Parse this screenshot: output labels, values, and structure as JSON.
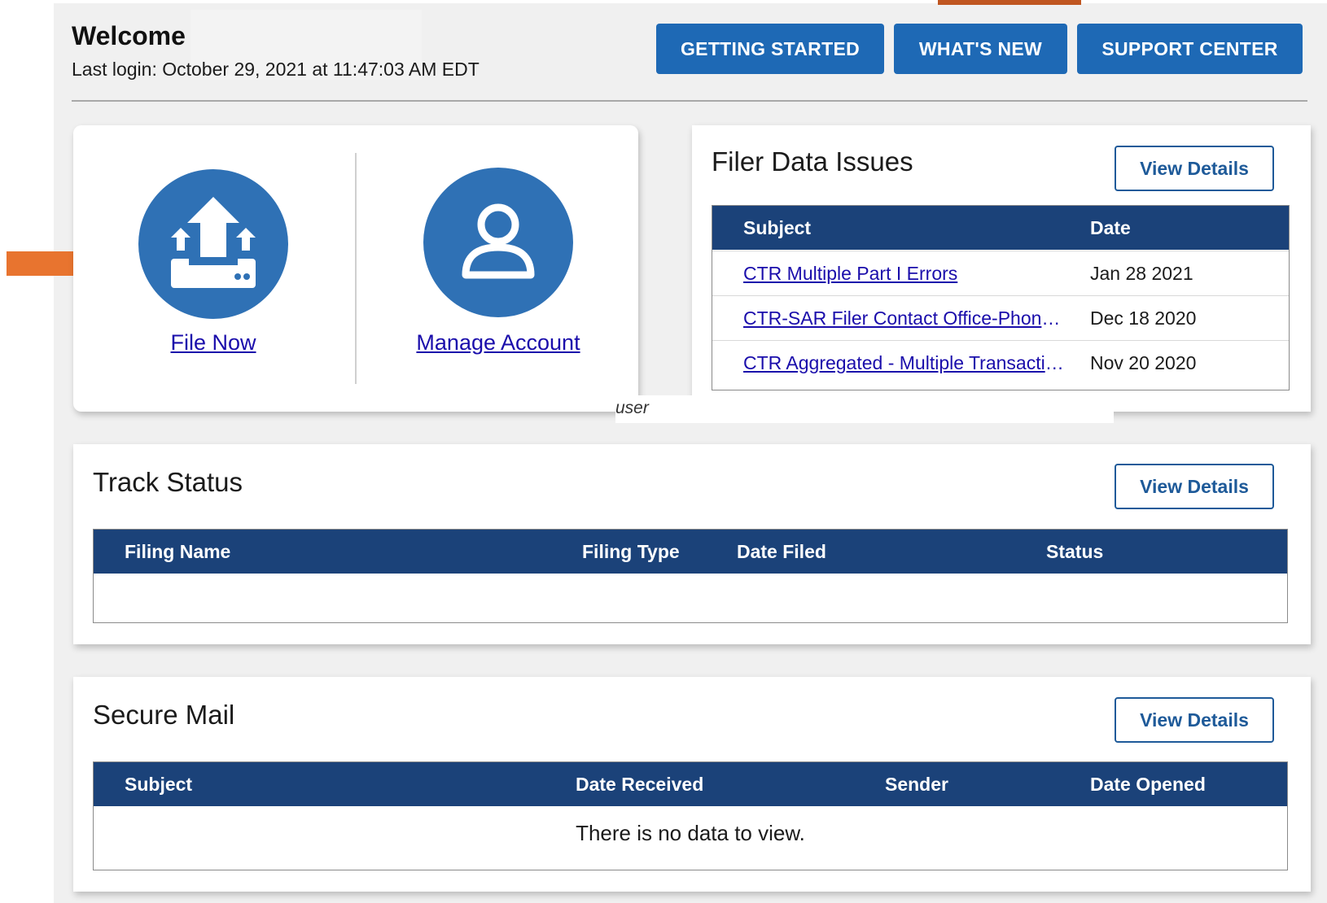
{
  "colors": {
    "primary_button": "#1e69b5",
    "table_header": "#1b4279",
    "icon_circle": "#2f71b5",
    "link": "#1a0dab",
    "annotation_arrow": "#e8742f"
  },
  "header": {
    "title": "Welcome",
    "last_login": "Last login: October 29, 2021 at 11:47:03 AM EDT",
    "buttons": [
      "GETTING STARTED",
      "WHAT'S NEW",
      "SUPPORT CENTER"
    ]
  },
  "quick_actions": {
    "file_now": {
      "label": "File Now",
      "icon": "upload-tray-icon"
    },
    "manage_account": {
      "label": "Manage Account",
      "icon": "user-icon"
    },
    "annotation_label": "user",
    "annotation_arrow_icon": "arrow-right-icon"
  },
  "filer_data_issues": {
    "title": "Filer Data Issues",
    "view_details": "View Details",
    "columns": [
      "Subject",
      "Date"
    ],
    "rows": [
      {
        "subject": "CTR Multiple Part I Errors",
        "date": "Jan 28 2021"
      },
      {
        "subject": "CTR-SAR Filer Contact Office-Phone Number",
        "date": "Dec 18 2020"
      },
      {
        "subject": "CTR Aggregated - Multiple Transactions",
        "date": "Nov 20 2020"
      }
    ]
  },
  "track_status": {
    "title": "Track Status",
    "view_details": "View Details",
    "columns": [
      "Filing Name",
      "Filing Type",
      "Date Filed",
      "Status"
    ]
  },
  "secure_mail": {
    "title": "Secure Mail",
    "view_details": "View Details",
    "columns": [
      "Subject",
      "Date Received",
      "Sender",
      "Date Opened"
    ],
    "empty_message": "There is no data to view."
  }
}
